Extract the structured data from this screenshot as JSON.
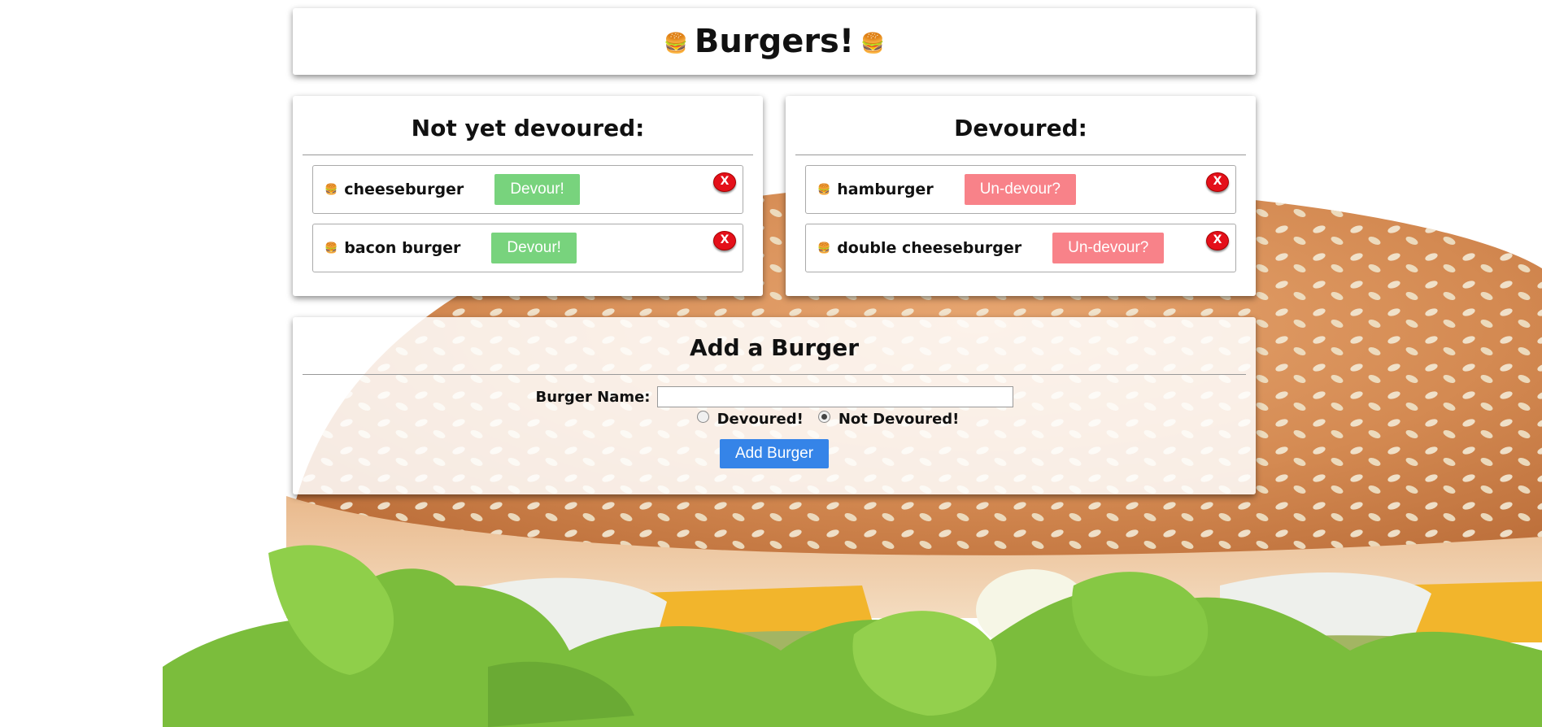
{
  "header": {
    "title": "Burgers!",
    "emoji_left": "🍔",
    "emoji_right": "🍔"
  },
  "not_devoured": {
    "heading": "Not yet devoured:",
    "items": [
      {
        "name": "cheeseburger",
        "button": "Devour!",
        "delete": "X",
        "emoji": "🍔"
      },
      {
        "name": "bacon burger",
        "button": "Devour!",
        "delete": "X",
        "emoji": "🍔"
      }
    ]
  },
  "devoured": {
    "heading": "Devoured:",
    "items": [
      {
        "name": "hamburger",
        "button": "Un-devour?",
        "delete": "X",
        "emoji": "🍔"
      },
      {
        "name": "double cheeseburger",
        "button": "Un-devour?",
        "delete": "X",
        "emoji": "🍔"
      }
    ]
  },
  "add_form": {
    "heading": "Add a Burger",
    "name_label": "Burger Name:",
    "name_value": "",
    "radio_devoured": "Devoured!",
    "radio_not_devoured": "Not Devoured!",
    "selected": "Not Devoured!",
    "submit": "Add Burger"
  },
  "colors": {
    "devour_button": "#78d37d",
    "undevour_button": "#f88289",
    "delete_button": "#e4101a",
    "add_button": "#3584e8"
  }
}
